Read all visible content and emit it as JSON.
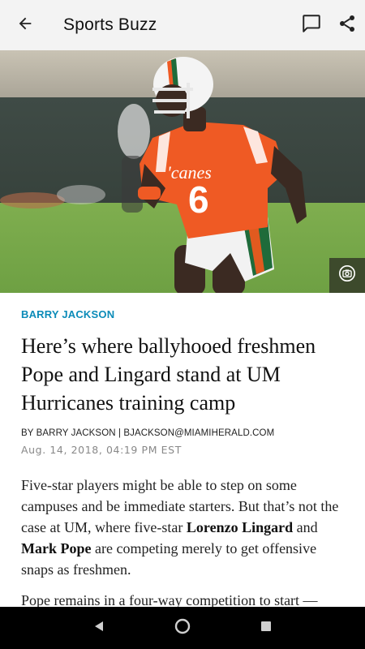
{
  "appbar": {
    "title": "Sports Buzz",
    "icons": [
      "arrow-back-icon",
      "comment-icon",
      "share-icon"
    ]
  },
  "hero": {
    "photo_icon": "camera-icon",
    "jersey_number": "6",
    "jersey_text": "'canes"
  },
  "article": {
    "author_tag": "BARRY JACKSON",
    "headline": "Here’s where ballyhooed freshmen Pope and Lingard stand at UM Hurricanes training camp",
    "byline": "BY BARRY JACKSON | BJACKSON@MIAMIHERALD.COM",
    "date": "Aug. 14, 2018, 04:19 PM EST",
    "paragraph1": {
      "part1": "Five-star players might be able to step on some campuses and be immediate starters. But that’s not the case at UM, where five-star ",
      "bold1": "Lorenzo Lingard",
      "part2": " and ",
      "bold2": "Mark Pope",
      "part3": " are competing merely to get offensive snaps as freshmen."
    },
    "paragraph2": "Pope remains in a four-way competition to start —"
  },
  "navbar": {
    "icons": [
      "nav-back-icon",
      "nav-home-icon",
      "nav-recents-icon"
    ]
  },
  "colors": {
    "accent": "#0b8bb8",
    "appbar_bg": "#f3f3f3",
    "navbar_bg": "#000000"
  }
}
